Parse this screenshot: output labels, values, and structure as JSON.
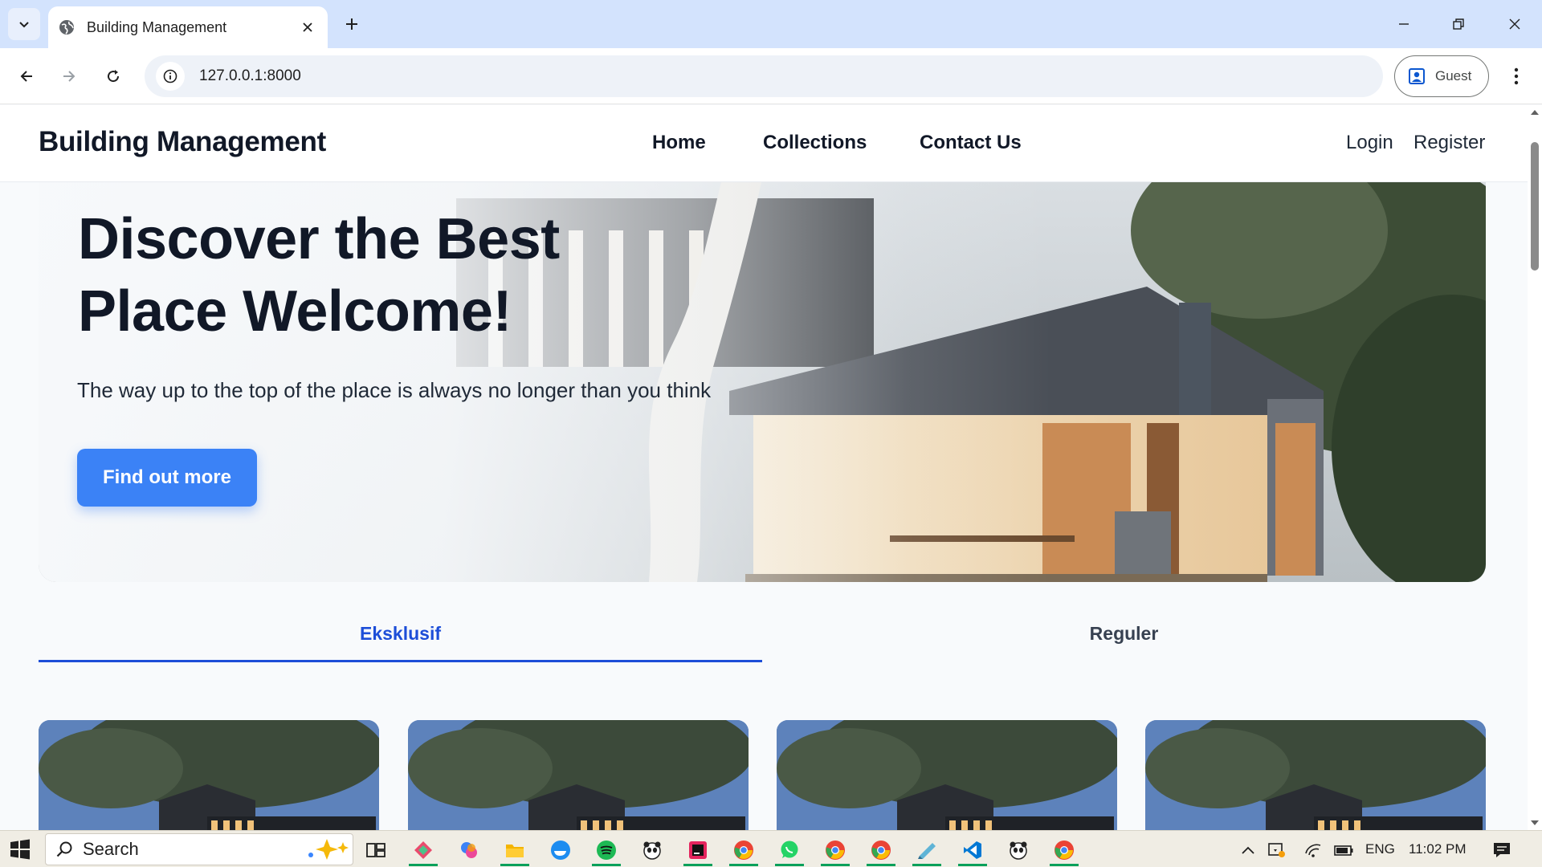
{
  "browser": {
    "tab_title": "Building Management",
    "url": "127.0.0.1:8000",
    "profile_label": "Guest"
  },
  "site": {
    "brand": "Building Management",
    "nav": [
      "Home",
      "Collections",
      "Contact Us"
    ],
    "auth": {
      "login": "Login",
      "register": "Register"
    }
  },
  "hero": {
    "title_line1": "Discover the Best",
    "title_line2": "Place Welcome!",
    "subtitle": "The way up to the top of the place is always no longer than you think",
    "cta": "Find out more"
  },
  "category_tabs": [
    {
      "label": "Eksklusif",
      "active": true
    },
    {
      "label": "Reguler",
      "active": false
    }
  ],
  "cards_visible": 4,
  "taskbar": {
    "search_placeholder": "Search",
    "language": "ENG",
    "time": "11:02 PM",
    "apps": [
      "task-view",
      "app-launcher",
      "copilot",
      "file-explorer",
      "docker",
      "spotify",
      "panda",
      "jetbrains",
      "chrome",
      "whatsapp",
      "chrome",
      "chrome",
      "notes",
      "vscode",
      "panda",
      "chrome"
    ]
  },
  "colors": {
    "accent": "#3b82f6",
    "tab_active": "#1d4ed8",
    "chrome_tabstrip": "#d3e3fd",
    "text_dark": "#111827"
  }
}
